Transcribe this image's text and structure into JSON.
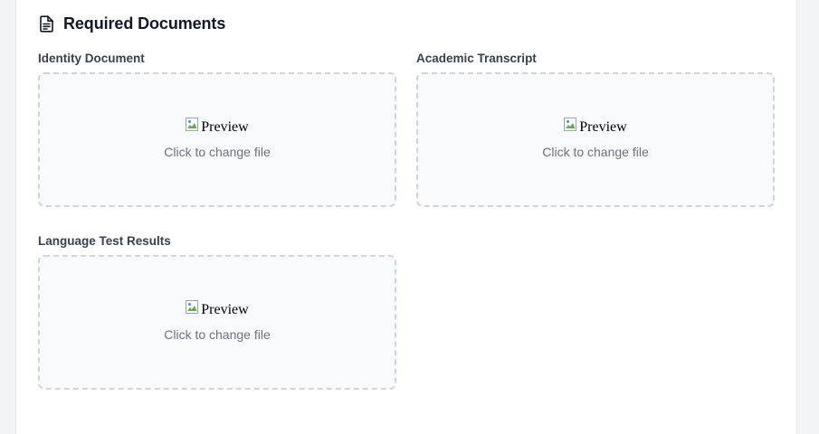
{
  "section": {
    "title": "Required Documents",
    "icon": "document-icon"
  },
  "fields": [
    {
      "label": "Identity Document",
      "preview_alt": "Preview",
      "change_text": "Click to change file"
    },
    {
      "label": "Academic Transcript",
      "preview_alt": "Preview",
      "change_text": "Click to change file"
    },
    {
      "label": "Language Test Results",
      "preview_alt": "Preview",
      "change_text": "Click to change file"
    }
  ],
  "colors": {
    "dropzone_border": "#d1d5db",
    "dropzone_background": "#f9fafb",
    "label_text": "#374151",
    "hint_text": "#6b7280"
  }
}
